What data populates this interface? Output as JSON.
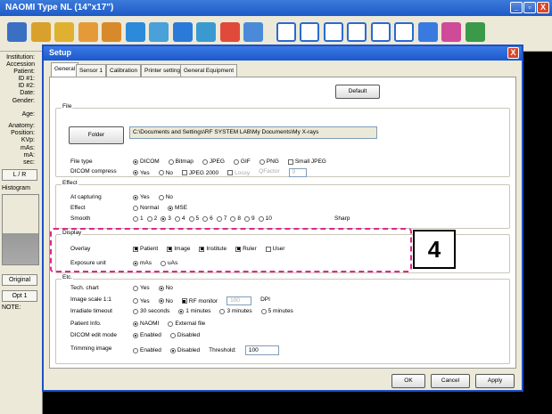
{
  "app": {
    "title": "NAOMI  Type NL (14\"x17\")",
    "min": "_",
    "max": "▫",
    "close": "X"
  },
  "toolbar": {
    "icons": [
      "camera-icon",
      "user-icon",
      "folder-icon",
      "save-icon",
      "print-icon",
      "rotate-icon",
      "zoom-icon",
      "flip-icon",
      "undo-icon",
      "redo-icon",
      "text-icon",
      "layout-1-icon",
      "layout-2-icon",
      "layout-3-icon",
      "layout-4-icon",
      "layout-5-icon",
      "layout-6-icon",
      "heart-icon",
      "tools-icon",
      "lock-icon"
    ]
  },
  "left": {
    "labels": [
      "Institution:",
      "Accession",
      "Patient:",
      "ID #1:",
      "ID #2:",
      "Date:",
      "Gender:",
      "Age:",
      "Anatomy:",
      "Position:",
      "KVp:",
      "mAs:",
      "mA:",
      "sec:"
    ],
    "lr": "L / R",
    "histogram": "Histogram",
    "original": "Original",
    "opt": "Opt 1",
    "note": "NOTE:"
  },
  "dialog": {
    "title": "Setup",
    "close": "X",
    "tabs": [
      "General",
      "Sensor 1",
      "Calibration",
      "Printer setting",
      "General Equipment"
    ],
    "default_btn": "Default",
    "file": {
      "legend": "File",
      "folder_btn": "Folder",
      "path": "C:\\Documents and Settings\\RF SYSTEM LAB\\My Documents\\My X-rays",
      "type_label": "File type",
      "types": [
        "DICOM",
        "Bitmap",
        "JPEG",
        "GIF",
        "PNG"
      ],
      "small_jpeg": "Small JPEG",
      "compress_label": "DICOM compress",
      "compress": [
        "Yes",
        "No"
      ],
      "jpeg2000": "JPEG 2000",
      "lossy": "Lossy",
      "qfactor": "QFactor",
      "qvalue": "0"
    },
    "effect": {
      "legend": "Effect",
      "capturing_label": "At capturing",
      "capturing": [
        "Yes",
        "No"
      ],
      "effect_label": "Effect",
      "effects": [
        "Normal",
        "MSE"
      ],
      "smooth_label": "Smooth",
      "smooth": [
        "1",
        "2",
        "3",
        "4",
        "5",
        "6",
        "7",
        "8",
        "9",
        "10"
      ],
      "sharp": "Sharp"
    },
    "display": {
      "legend": "Display",
      "overlay_label": "Overlay",
      "overlay": [
        "Patient",
        "Image",
        "Institute",
        "Ruler",
        "User"
      ],
      "exposure_label": "Exposure unit",
      "exposure": [
        "mAs",
        "uAs"
      ]
    },
    "etc": {
      "legend": "Etc.",
      "tech_label": "Tech. chart",
      "tech": [
        "Yes",
        "No"
      ],
      "scale_label": "Image scale 1:1",
      "scale": [
        "Yes",
        "No"
      ],
      "rfmonitor": "RF monitor",
      "dpi_value": "100",
      "dpi": "DPI",
      "timeout_label": "Irradiate timeout",
      "timeout": [
        "30 seconds",
        "1 minutes",
        "3 minutes",
        "5 minutes"
      ],
      "patinfo_label": "Patient Info.",
      "patinfo": [
        "NAOMI",
        "External file"
      ],
      "dicomedit_label": "DICOM edit mode",
      "dicomedit": [
        "Enabled",
        "Disabled"
      ],
      "trim_label": "Trimming image",
      "trim": [
        "Enabled",
        "Disabled"
      ],
      "threshold": "Threshold:",
      "threshold_value": "100"
    },
    "ok": "OK",
    "cancel": "Cancel",
    "apply": "Apply"
  },
  "callout": "4",
  "colors": {
    "highlight": "#e0278a",
    "titlebar": "#1e5ac8"
  }
}
